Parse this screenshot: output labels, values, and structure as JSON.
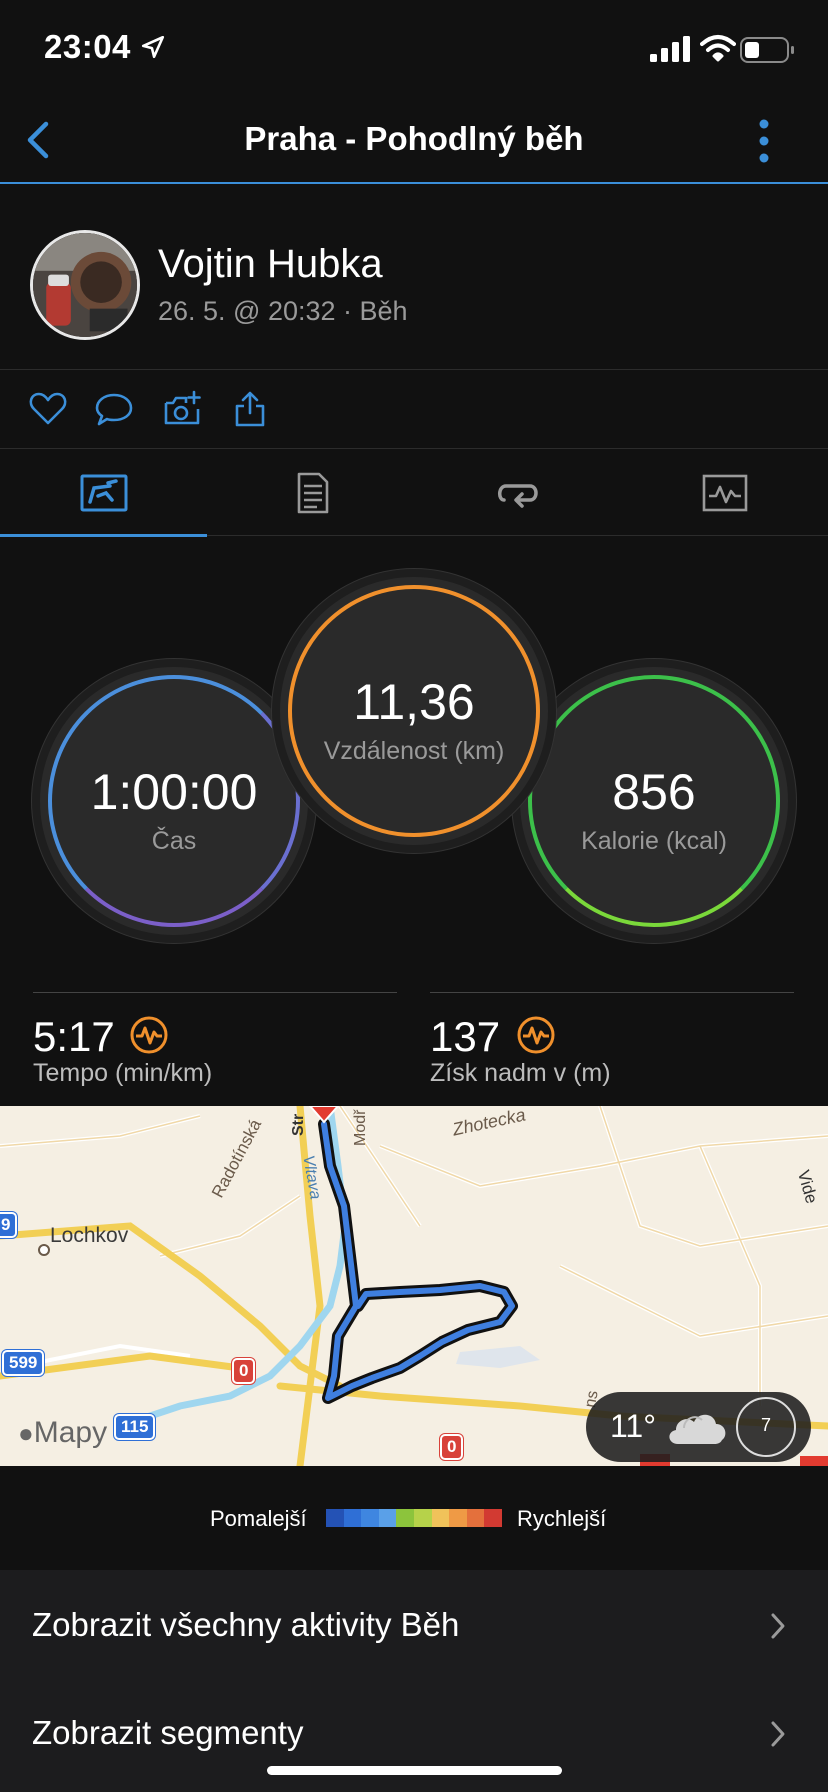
{
  "status_bar": {
    "time": "23:04",
    "icons": [
      "location-arrow-icon",
      "signal-icon",
      "wifi-icon",
      "battery-icon"
    ]
  },
  "nav": {
    "title": "Praha - Pohodlný běh",
    "back_icon": "chevron-left-icon",
    "more_icon": "more-vertical-icon",
    "accent": "#3b8fd9"
  },
  "user": {
    "name": "Vojtin Hubka",
    "meta": "26. 5. @ 20:32 · Běh"
  },
  "actions": [
    "heart-icon",
    "comment-icon",
    "add-photo-icon",
    "share-icon"
  ],
  "tabs": [
    {
      "icon": "summary-icon",
      "active": true
    },
    {
      "icon": "details-icon",
      "active": false
    },
    {
      "icon": "laps-icon",
      "active": false
    },
    {
      "icon": "charts-icon",
      "active": false
    }
  ],
  "summary": {
    "time": {
      "value": "1:00:00",
      "label": "Čas"
    },
    "distance": {
      "value": "11,36",
      "label": "Vzdálenost (km)"
    },
    "calories": {
      "value": "856",
      "label": "Kalorie (kcal)"
    }
  },
  "stats": [
    {
      "value": "5:17",
      "label": "Tempo (min/km)",
      "icon": "pulse-icon"
    },
    {
      "value": "137",
      "label": "Získ nadm v (m)",
      "icon": "pulse-icon"
    }
  ],
  "map": {
    "labels": {
      "lochkov": "Lochkov",
      "radotinska": "Radotínská",
      "zhotecka": "Zhotecka",
      "vltava": "Vltava",
      "modr": "Modř",
      "str": "Str",
      "vide": "Vide",
      "ns": "ns"
    },
    "shields": {
      "s599": "599",
      "s115": "115",
      "s9": "9",
      "s0a": "0",
      "s0b": "0"
    },
    "attribution": "Mapy",
    "weather": {
      "temp": "11°",
      "wind": "7",
      "icon": "cloud-icon"
    }
  },
  "legend": {
    "slower": "Pomalejší",
    "faster": "Rychlejší",
    "colors": [
      "#2452b5",
      "#2f6fd6",
      "#3f86e0",
      "#5aa0e8",
      "#8cc43c",
      "#b6d24a",
      "#f0c25a",
      "#ef9a45",
      "#e4703c",
      "#d23a32"
    ]
  },
  "links": [
    {
      "label": "Zobrazit všechny aktivity Běh"
    },
    {
      "label": "Zobrazit segmenty"
    }
  ]
}
